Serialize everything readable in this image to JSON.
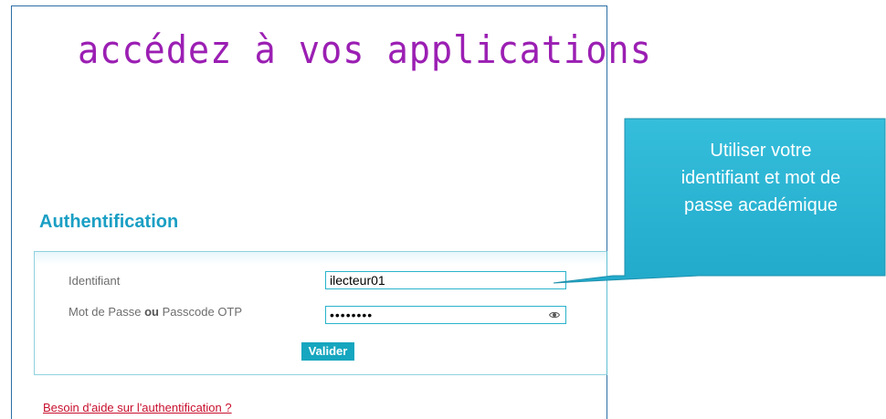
{
  "header": {
    "title": "accédez à vos applications"
  },
  "auth": {
    "section_title": "Authentification",
    "id_label": "Identifiant",
    "id_value": "ilecteur01",
    "pw_label_prefix": "Mot de Passe ",
    "pw_label_bold": "ou",
    "pw_label_suffix": " Passcode OTP",
    "pw_masked": "••••••••",
    "submit_label": "Valider",
    "help_link": "Besoin d'aide sur l'authentification ?"
  },
  "callout": {
    "text_line1": "Utiliser votre",
    "text_line2": "identifiant et mot de",
    "text_line3": "passe académique"
  },
  "colors": {
    "title": "#9b1fb3",
    "accent": "#16a6bf",
    "callout_fill": "#2ab4d4",
    "link": "#c8102e",
    "frame": "#2b6fa6"
  },
  "icons": {
    "password_toggle": "eye-icon"
  }
}
